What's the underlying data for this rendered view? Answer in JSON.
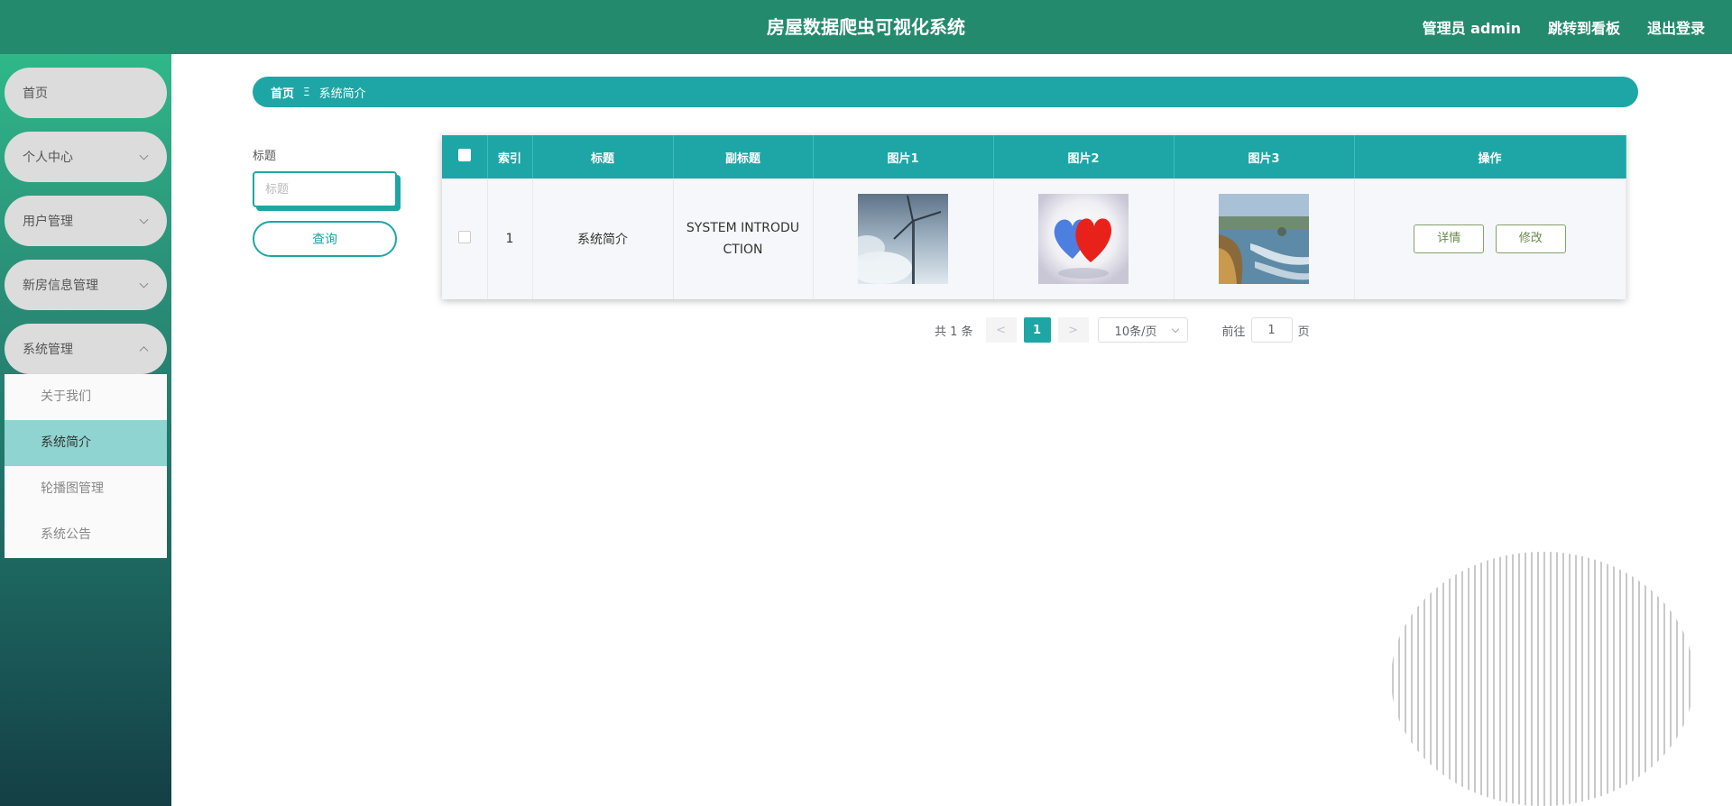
{
  "header": {
    "title": "房屋数据爬虫可视化系统",
    "admin": "管理员 admin",
    "dashboard_link": "跳转到看板",
    "logout": "退出登录",
    "bg_color": "#248a6d"
  },
  "sidebar": {
    "items": [
      {
        "label": "首页"
      },
      {
        "label": "个人中心"
      },
      {
        "label": "用户管理"
      },
      {
        "label": "新房信息管理"
      },
      {
        "label": "系统管理"
      }
    ],
    "submenu": [
      {
        "label": "关于我们"
      },
      {
        "label": "系统简介"
      },
      {
        "label": "轮播图管理"
      },
      {
        "label": "系统公告"
      }
    ]
  },
  "breadcrumb": {
    "home": "首页",
    "separator": "Ξ",
    "current": "系统简介"
  },
  "search": {
    "label": "标题",
    "placeholder": "标题",
    "button": "查询"
  },
  "table": {
    "columns": [
      "索引",
      "标题",
      "副标题",
      "图片1",
      "图片2",
      "图片3",
      "操作"
    ],
    "rows": [
      {
        "index": "1",
        "title": "系统简介",
        "subtitle": "SYSTEM INTRODUCTION",
        "images": [
          "wind-turbine-image",
          "hearts-image",
          "coast-image"
        ],
        "actions": [
          "详情",
          "修改"
        ]
      }
    ],
    "header_color": "#1ea6a6"
  },
  "pagination": {
    "total": "共 1 条",
    "prev": "<",
    "current_page": "1",
    "next": ">",
    "page_size": "10条/页",
    "goto_label": "前往",
    "goto_value": "1",
    "page_suffix": "页"
  }
}
